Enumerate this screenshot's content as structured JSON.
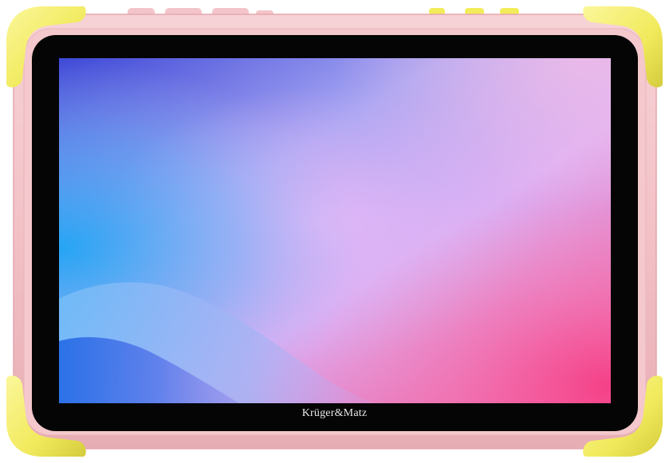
{
  "device": {
    "brand_label": "Krüger&Matz",
    "colors": {
      "shell": "#f2c1c6",
      "shell_shadow": "#e5a9b0",
      "bumper": "#f4ef6e",
      "bumper_shadow": "#d9d24a",
      "bezel": "#050505",
      "button_pink": "#f3c5ca",
      "button_yellow": "#f2ec5a"
    }
  },
  "screen": {
    "wallpaper_colors": {
      "top_left": "#3f4fd8",
      "top_center": "#8e9cf1",
      "center": "#d8b2f5",
      "right": "#f59ecb",
      "bottom_right": "#f4508e",
      "left": "#27a6f3",
      "wave_light": "#8cc3f8",
      "wave_dark": "#2a6fe6"
    }
  }
}
